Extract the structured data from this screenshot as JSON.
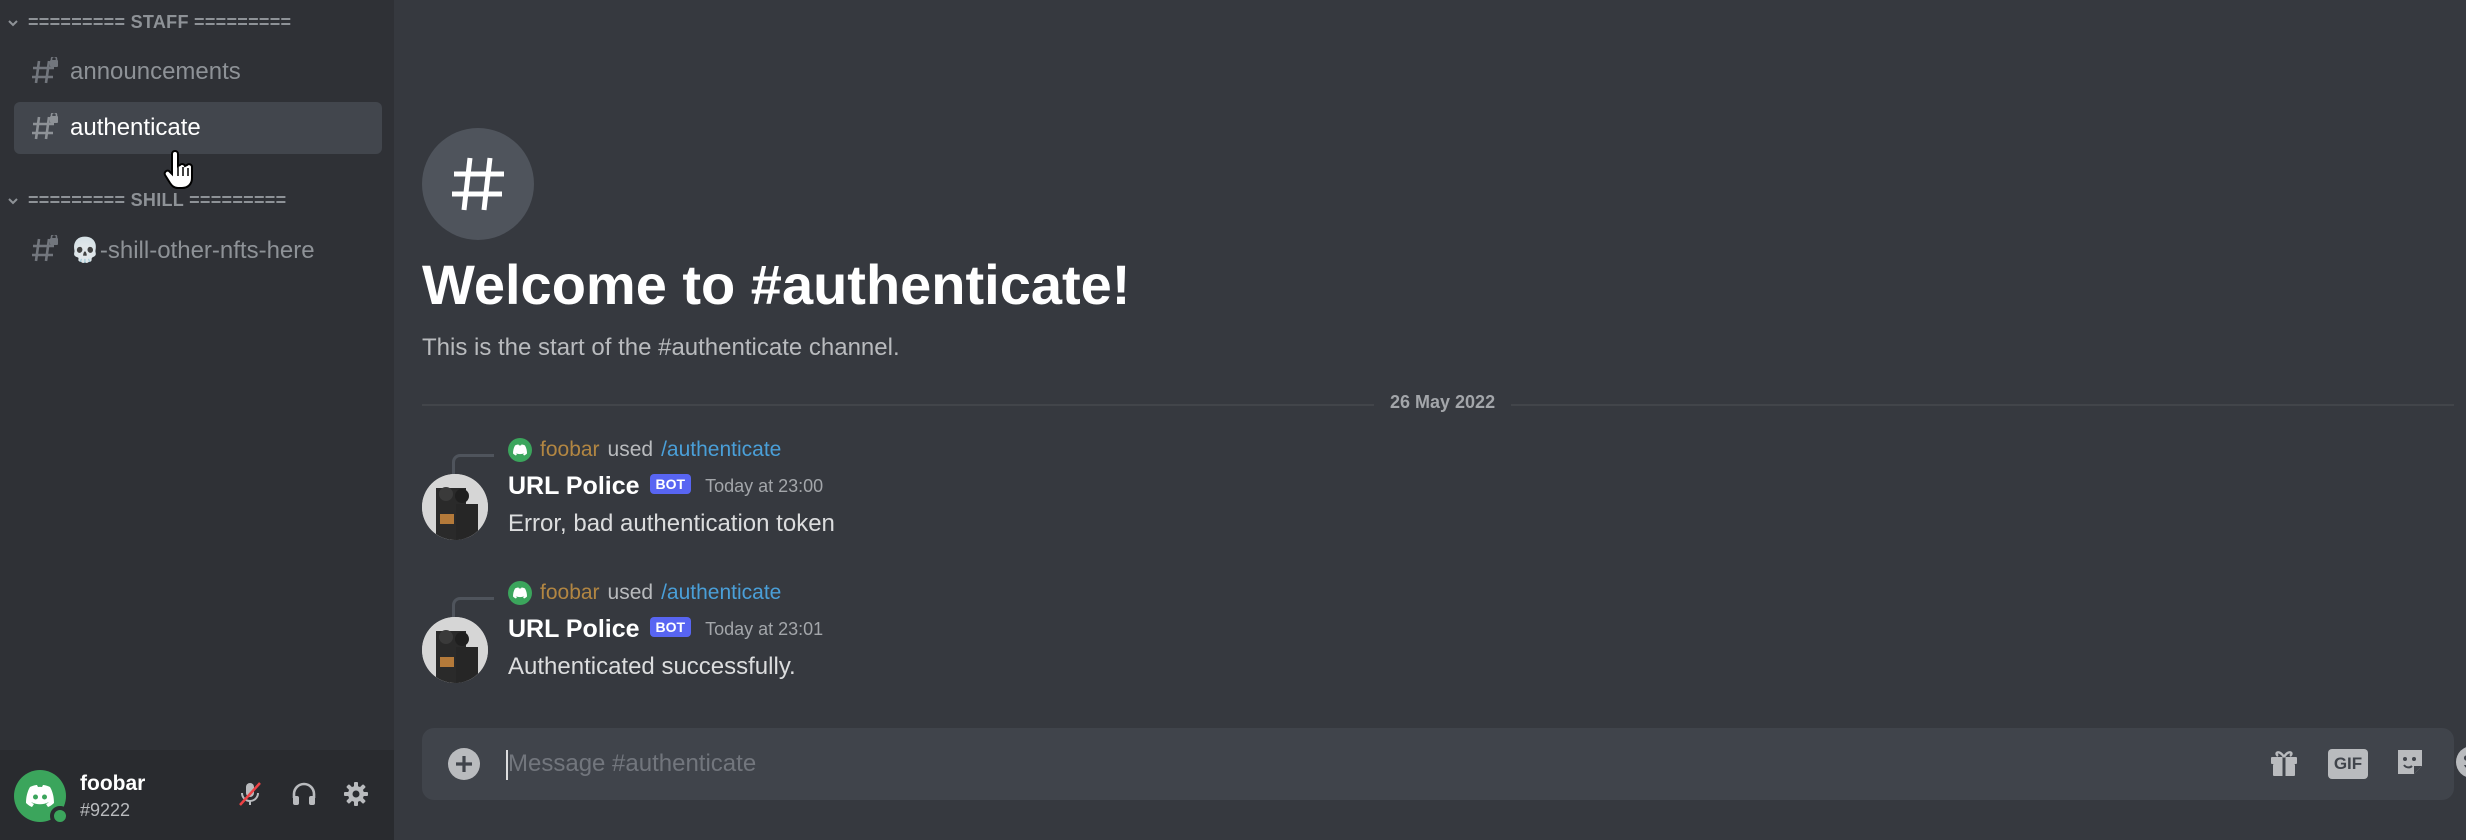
{
  "sidebar": {
    "categories": [
      {
        "label": "========= STAFF ========="
      },
      {
        "label": "========= SHILL ========="
      }
    ],
    "channels": [
      {
        "label": "announcements",
        "active": false
      },
      {
        "label": "authenticate",
        "active": true
      },
      {
        "label": "💀-shill-other-nfts-here",
        "active": false
      }
    ]
  },
  "user_panel": {
    "name": "foobar",
    "tag": "#9222",
    "status_color": "#3ba55c",
    "icons": [
      "mic-muted-icon",
      "headphones-icon",
      "gear-icon"
    ]
  },
  "main": {
    "welcome_title": "Welcome to #authenticate!",
    "welcome_sub": "This is the start of the #authenticate channel.",
    "date_divider": "26 May 2022",
    "messages": [
      {
        "reply_user": "foobar",
        "reply_used": "used",
        "reply_command": "/authenticate",
        "author": "URL Police",
        "bot_tag": "BOT",
        "time": "Today at 23:00",
        "text": "Error, bad authentication token"
      },
      {
        "reply_user": "foobar",
        "reply_used": "used",
        "reply_command": "/authenticate",
        "author": "URL Police",
        "bot_tag": "BOT",
        "time": "Today at 23:01",
        "text": "Authenticated successfully."
      }
    ]
  },
  "composer": {
    "placeholder": "Message #authenticate",
    "value": "",
    "gif_label": "GIF",
    "icons": [
      "add-icon",
      "gift-icon",
      "gif-icon",
      "sticker-icon",
      "emoji-icon"
    ]
  },
  "colors": {
    "sidebar_bg": "#2f3136",
    "main_bg": "#36393f",
    "accent": "#5865f2",
    "link": "#4a9fd8",
    "username_reply": "#b28642"
  }
}
